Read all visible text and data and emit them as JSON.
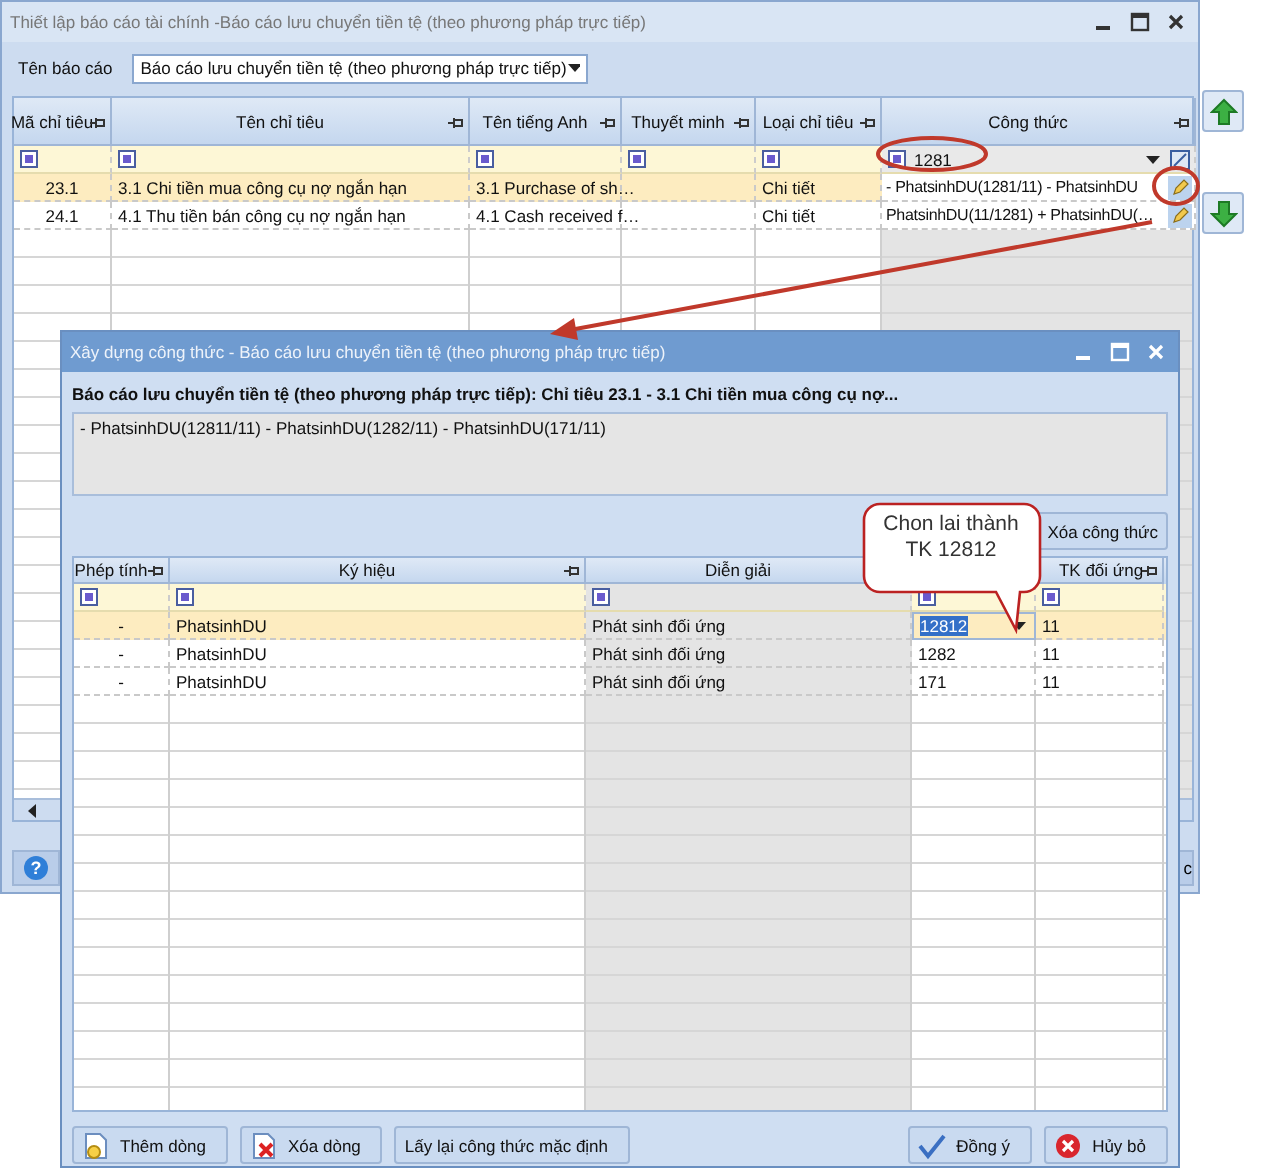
{
  "main_window": {
    "title": "Thiết lập báo cáo tài chính -Báo cáo lưu chuyển tiền tệ (theo phương pháp trực tiếp)",
    "report_label": "Tên báo cáo",
    "report_value": "Báo cáo lưu chuyển tiền tệ (theo phương pháp trực tiếp)",
    "columns": [
      "Mã chỉ tiêu",
      "Tên chỉ tiêu",
      "Tên tiếng Anh",
      "Thuyết minh",
      "Loại chỉ tiêu",
      "Công thức"
    ],
    "formula_filter": "1281",
    "rows": [
      {
        "code": "23.1",
        "name": "3.1 Chi tiền mua công cụ nợ ngắn hạn",
        "english_name": "3.1 Purchase of sh…",
        "type": "Chi tiết",
        "formula": "- PhatsinhDU(1281/11) - PhatsinhDU",
        "selected": true
      },
      {
        "code": "24.1",
        "name": "4.1 Thu tiền bán công cụ nợ ngắn hạn",
        "english_name": "4.1 Cash received f…",
        "type": "Chi tiết",
        "formula": "PhatsinhDU(11/1281) + PhatsinhDU(…",
        "selected": false
      }
    ],
    "help_button": "?",
    "partial_button": "c"
  },
  "dialog": {
    "title": "Xây dựng công thức - Báo cáo lưu chuyển tiền tệ (theo phương pháp trực tiếp)",
    "heading": "Báo cáo lưu chuyển tiền tệ (theo phương pháp trực tiếp): Chỉ tiêu 23.1 - 3.1 Chi tiền mua công cụ nợ...",
    "formula_text": "- PhatsinhDU(12811/11) - PhatsinhDU(1282/11) - PhatsinhDU(171/11)",
    "clear_button": "Xóa công thức",
    "columns": [
      "Phép tính",
      "Ký hiệu",
      "Diễn giải",
      "TK đối ứng"
    ],
    "rows": [
      {
        "operator": "-",
        "symbol": "PhatsinhDU",
        "description": "Phát sinh đối ứng",
        "account": "12812",
        "contra_account": "11",
        "selected": true
      },
      {
        "operator": "-",
        "symbol": "PhatsinhDU",
        "description": "Phát sinh đối ứng",
        "account": "1282",
        "contra_account": "11",
        "selected": false
      },
      {
        "operator": "-",
        "symbol": "PhatsinhDU",
        "description": "Phát sinh đối ứng",
        "account": "171",
        "contra_account": "11",
        "selected": false
      }
    ],
    "left_buttons": [
      {
        "label": "Thêm dòng",
        "kind": "add"
      },
      {
        "label": "Xóa dòng",
        "kind": "delete"
      },
      {
        "label": "Lấy lại công thức mặc định",
        "kind": "plain"
      }
    ],
    "right_buttons": [
      {
        "label": "Đồng ý",
        "kind": "ok"
      },
      {
        "label": "Hủy bỏ",
        "kind": "cancel"
      }
    ]
  },
  "callout": {
    "text": "Chon lai thành\nTK 12812"
  }
}
